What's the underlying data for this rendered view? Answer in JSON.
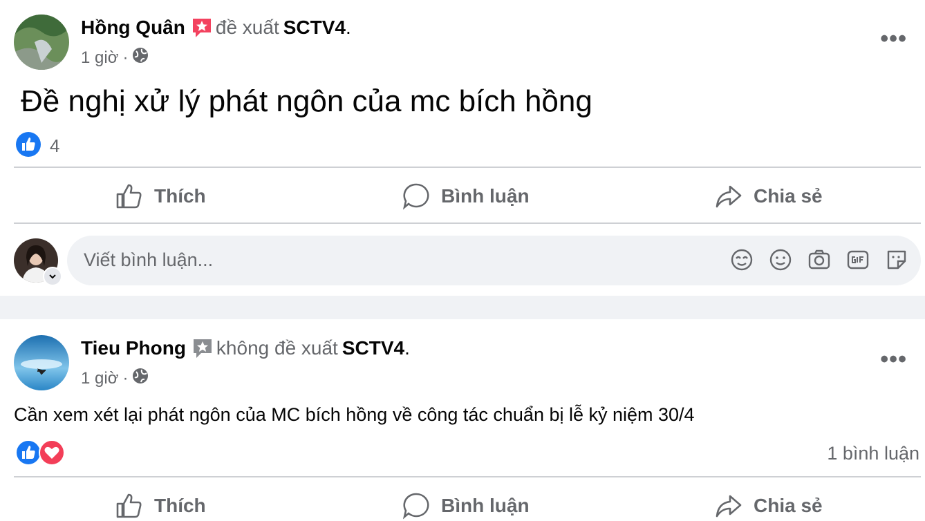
{
  "posts": [
    {
      "author": "Hồng Quân",
      "verb": "đề xuất",
      "page": "SCTV4",
      "period": ".",
      "time": "1 giờ",
      "separator": "·",
      "text": "Đề nghị xử lý phát ngôn của mc bích hồng",
      "reaction_count": "4",
      "recommend_icon_color": "#f3425f"
    },
    {
      "author": "Tieu Phong",
      "verb": "không đề xuất",
      "page": "SCTV4",
      "period": ".",
      "time": "1 giờ",
      "separator": "·",
      "text": "Cần xem xét lại phát ngôn của MC bích hồng về công tác chuẩn bị lễ kỷ niệm 30/4",
      "comment_count": "1 bình luận",
      "recommend_icon_color": "#8a8d91"
    }
  ],
  "actions": {
    "like": "Thích",
    "comment": "Bình luận",
    "share": "Chia sẻ"
  },
  "comment_box": {
    "placeholder": "Viết bình luận..."
  },
  "more_label": "•••",
  "colors": {
    "like_blue": "#1877f2",
    "love_red": "#f33e58",
    "secondary_text": "#65676b"
  }
}
